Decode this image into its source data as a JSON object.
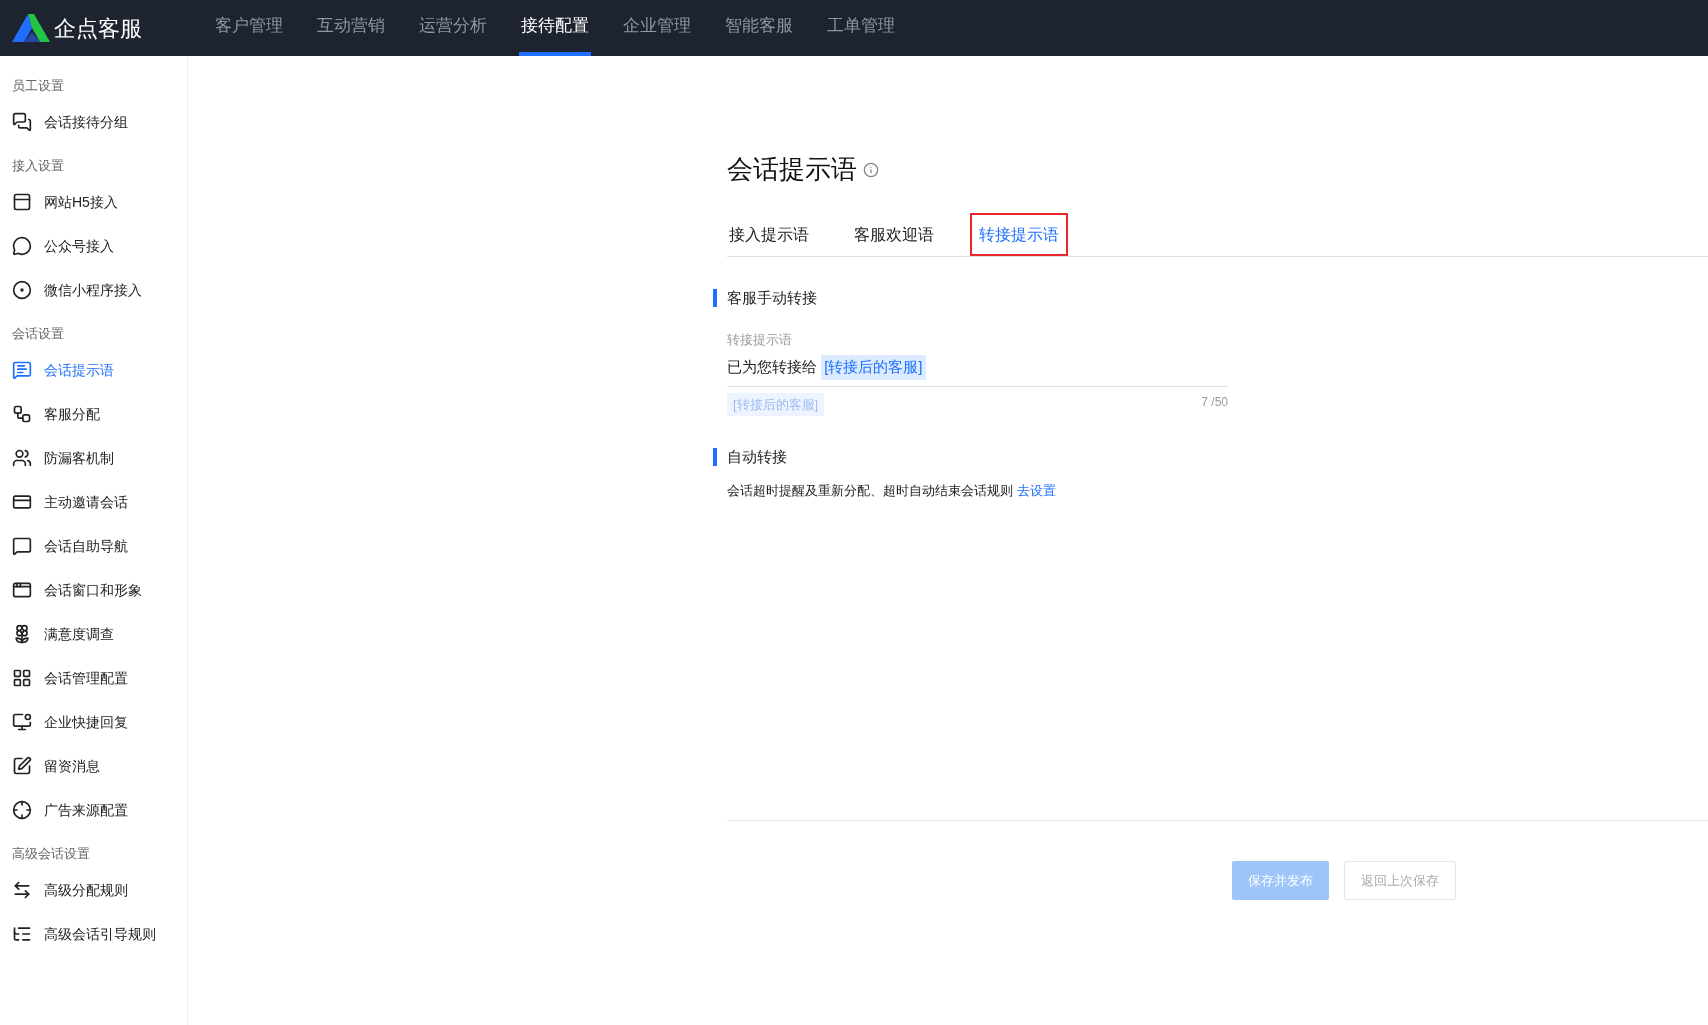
{
  "brand": {
    "name": "企点客服"
  },
  "nav": [
    {
      "label": "客户管理",
      "selected": false
    },
    {
      "label": "互动营销",
      "selected": false
    },
    {
      "label": "运营分析",
      "selected": false
    },
    {
      "label": "接待配置",
      "selected": true
    },
    {
      "label": "企业管理",
      "selected": false
    },
    {
      "label": "智能客服",
      "selected": false
    },
    {
      "label": "工单管理",
      "selected": false
    }
  ],
  "sidebar": [
    {
      "heading": "员工设置",
      "items": [
        {
          "label": "会话接待分组",
          "selected": false
        }
      ]
    },
    {
      "heading": "接入设置",
      "items": [
        {
          "label": "网站H5接入",
          "selected": false
        },
        {
          "label": "公众号接入",
          "selected": false
        },
        {
          "label": "微信小程序接入",
          "selected": false
        }
      ]
    },
    {
      "heading": "会话设置",
      "items": [
        {
          "label": "会话提示语",
          "selected": true
        },
        {
          "label": "客服分配",
          "selected": false
        },
        {
          "label": "防漏客机制",
          "selected": false
        },
        {
          "label": "主动邀请会话",
          "selected": false
        },
        {
          "label": "会话自助导航",
          "selected": false
        },
        {
          "label": "会话窗口和形象",
          "selected": false
        },
        {
          "label": "满意度调查",
          "selected": false
        },
        {
          "label": "会话管理配置",
          "selected": false
        },
        {
          "label": "企业快捷回复",
          "selected": false
        },
        {
          "label": "留资消息",
          "selected": false
        },
        {
          "label": "广告来源配置",
          "selected": false
        }
      ]
    },
    {
      "heading": "高级会话设置",
      "items": [
        {
          "label": "高级分配规则",
          "selected": false
        },
        {
          "label": "高级会话引导规则",
          "selected": false
        }
      ]
    }
  ],
  "page": {
    "title": "会话提示语"
  },
  "tabs": [
    {
      "label": "接入提示语",
      "selected": false,
      "highlighted": false
    },
    {
      "label": "客服欢迎语",
      "selected": false,
      "highlighted": false
    },
    {
      "label": "转接提示语",
      "selected": true,
      "highlighted": true
    }
  ],
  "sections": [
    {
      "heading": "客服手动转接",
      "field": {
        "label": "转接提示语",
        "value": [
          {
            "kind": "text",
            "text": "已为您转接给 "
          },
          {
            "kind": "variable",
            "text": "[转接后的客服]"
          }
        ],
        "variables": [
          "[转接后的客服]"
        ],
        "counter": "7 /50"
      }
    },
    {
      "heading": "自动转接",
      "note": {
        "text": "会话超时提醒及重新分配、超时自动结束会话规则",
        "link": "去设置"
      }
    }
  ],
  "buttons": [
    {
      "label": "保存并发布",
      "kind": "primary",
      "disabled": true
    },
    {
      "label": "返回上次保存",
      "kind": "secondary",
      "disabled": true
    }
  ]
}
